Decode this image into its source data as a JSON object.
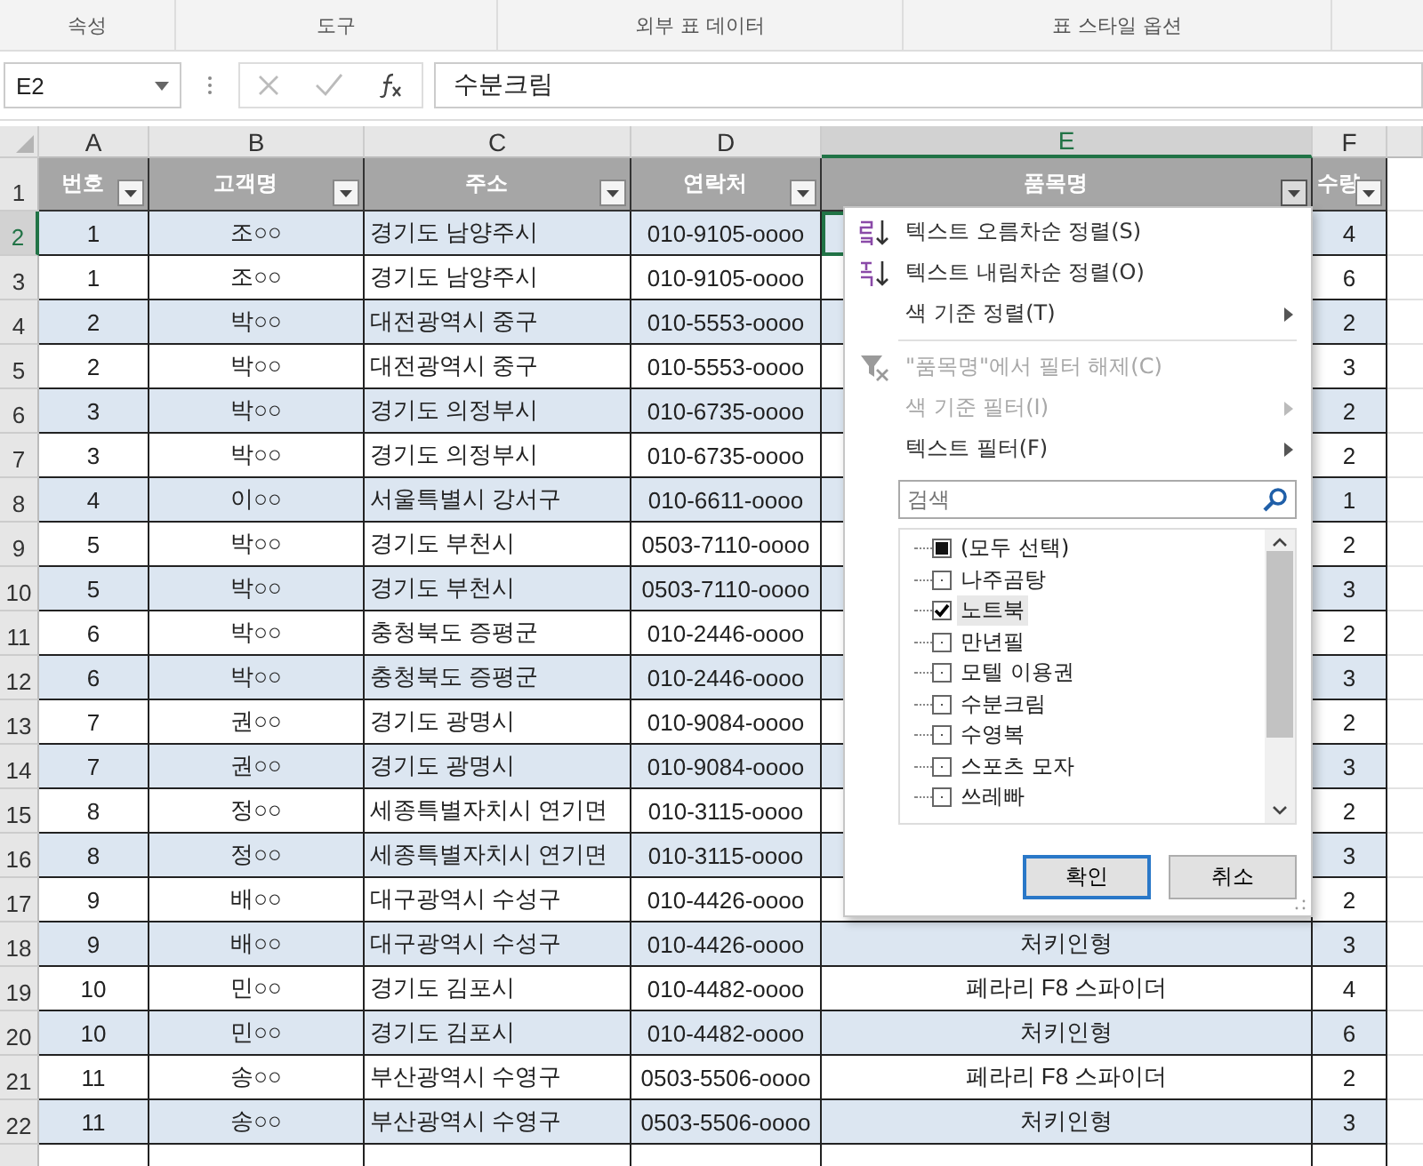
{
  "ribbon_groups": [
    "속성",
    "도구",
    "외부 표 데이터",
    "표 스타일 옵션"
  ],
  "name_box": "E2",
  "formula": "수분크림",
  "columns": [
    {
      "label": "A",
      "selected": false
    },
    {
      "label": "B",
      "selected": false
    },
    {
      "label": "C",
      "selected": false
    },
    {
      "label": "D",
      "selected": false
    },
    {
      "label": "E",
      "selected": true
    },
    {
      "label": "F",
      "selected": false
    }
  ],
  "headers": [
    {
      "label": "번호",
      "filter_open": false
    },
    {
      "label": "고객명",
      "filter_open": false
    },
    {
      "label": "주소",
      "filter_open": false
    },
    {
      "label": "연락처",
      "filter_open": false
    },
    {
      "label": "품목명",
      "filter_open": true
    },
    {
      "label": "수량",
      "filter_open": false
    }
  ],
  "header_row_number": "1",
  "rows": [
    {
      "row_number": "2",
      "selected": true,
      "cells": [
        "1",
        "조○○",
        "경기도 남양주시",
        "010-9105-oooo",
        null,
        "4"
      ]
    },
    {
      "row_number": "3",
      "selected": false,
      "cells": [
        "1",
        "조○○",
        "경기도 남양주시",
        "010-9105-oooo",
        null,
        "6"
      ]
    },
    {
      "row_number": "4",
      "selected": false,
      "cells": [
        "2",
        "박○○",
        "대전광역시 중구",
        "010-5553-oooo",
        null,
        "2"
      ]
    },
    {
      "row_number": "5",
      "selected": false,
      "cells": [
        "2",
        "박○○",
        "대전광역시 중구",
        "010-5553-oooo",
        null,
        "3"
      ]
    },
    {
      "row_number": "6",
      "selected": false,
      "cells": [
        "3",
        "박○○",
        "경기도 의정부시",
        "010-6735-oooo",
        null,
        "2"
      ]
    },
    {
      "row_number": "7",
      "selected": false,
      "cells": [
        "3",
        "박○○",
        "경기도 의정부시",
        "010-6735-oooo",
        null,
        "2"
      ]
    },
    {
      "row_number": "8",
      "selected": false,
      "cells": [
        "4",
        "이○○",
        "서울특별시 강서구",
        "010-6611-oooo",
        null,
        "1"
      ]
    },
    {
      "row_number": "9",
      "selected": false,
      "cells": [
        "5",
        "박○○",
        "경기도 부천시",
        "0503-7110-oooo",
        null,
        "2"
      ]
    },
    {
      "row_number": "10",
      "selected": false,
      "cells": [
        "5",
        "박○○",
        "경기도 부천시",
        "0503-7110-oooo",
        null,
        "3"
      ]
    },
    {
      "row_number": "11",
      "selected": false,
      "cells": [
        "6",
        "박○○",
        "충청북도 증평군",
        "010-2446-oooo",
        null,
        "2"
      ]
    },
    {
      "row_number": "12",
      "selected": false,
      "cells": [
        "6",
        "박○○",
        "충청북도 증평군",
        "010-2446-oooo",
        null,
        "3"
      ]
    },
    {
      "row_number": "13",
      "selected": false,
      "cells": [
        "7",
        "권○○",
        "경기도 광명시",
        "010-9084-oooo",
        null,
        "2"
      ]
    },
    {
      "row_number": "14",
      "selected": false,
      "cells": [
        "7",
        "권○○",
        "경기도 광명시",
        "010-9084-oooo",
        null,
        "3"
      ]
    },
    {
      "row_number": "15",
      "selected": false,
      "cells": [
        "8",
        "정○○",
        "세종특별자치시 연기면",
        "010-3115-oooo",
        null,
        "2"
      ]
    },
    {
      "row_number": "16",
      "selected": false,
      "cells": [
        "8",
        "정○○",
        "세종특별자치시 연기면",
        "010-3115-oooo",
        null,
        "3"
      ]
    },
    {
      "row_number": "17",
      "selected": false,
      "cells": [
        "9",
        "배○○",
        "대구광역시 수성구",
        "010-4426-oooo",
        null,
        "2"
      ]
    },
    {
      "row_number": "18",
      "selected": false,
      "cells": [
        "9",
        "배○○",
        "대구광역시 수성구",
        "010-4426-oooo",
        "처키인형",
        "3"
      ]
    },
    {
      "row_number": "19",
      "selected": false,
      "cells": [
        "10",
        "민○○",
        "경기도 김포시",
        "010-4482-oooo",
        "페라리 F8 스파이더",
        "4"
      ]
    },
    {
      "row_number": "20",
      "selected": false,
      "cells": [
        "10",
        "민○○",
        "경기도 김포시",
        "010-4482-oooo",
        "처키인형",
        "6"
      ]
    },
    {
      "row_number": "21",
      "selected": false,
      "cells": [
        "11",
        "송○○",
        "부산광역시 수영구",
        "0503-5506-oooo",
        "페라리 F8 스파이더",
        "2"
      ]
    },
    {
      "row_number": "22",
      "selected": false,
      "cells": [
        "11",
        "송○○",
        "부산광역시 수영구",
        "0503-5506-oooo",
        "처키인형",
        "3"
      ]
    }
  ],
  "filter_menu": {
    "items": [
      {
        "kind": "sort_asc",
        "label": "텍스트 오름차순 정렬(S)",
        "disabled": false,
        "submenu": false
      },
      {
        "kind": "sort_desc",
        "label": "텍스트 내림차순 정렬(O)",
        "disabled": false,
        "submenu": false
      },
      {
        "kind": "plain",
        "label": "색 기준 정렬(T)",
        "disabled": false,
        "submenu": true
      },
      {
        "kind": "separator"
      },
      {
        "kind": "clear_filter",
        "label": "\"품목명\"에서 필터 해제(C)",
        "disabled": true,
        "submenu": false
      },
      {
        "kind": "plain",
        "label": "색 기준 필터(I)",
        "disabled": true,
        "submenu": true
      },
      {
        "kind": "plain",
        "label": "텍스트 필터(F)",
        "disabled": false,
        "submenu": true
      }
    ],
    "search": {
      "placeholder": "검색"
    },
    "values": [
      {
        "label": "(모두 선택)",
        "checked": false,
        "partial": true,
        "selected": false
      },
      {
        "label": "나주곰탕",
        "checked": false,
        "partial": false,
        "selected": false
      },
      {
        "label": "노트북",
        "checked": true,
        "partial": false,
        "selected": true
      },
      {
        "label": "만년필",
        "checked": false,
        "partial": false,
        "selected": false
      },
      {
        "label": "모텔 이용권",
        "checked": false,
        "partial": false,
        "selected": false
      },
      {
        "label": "수분크림",
        "checked": false,
        "partial": false,
        "selected": false
      },
      {
        "label": "수영복",
        "checked": false,
        "partial": false,
        "selected": false
      },
      {
        "label": "스포츠 모자",
        "checked": false,
        "partial": false,
        "selected": false
      },
      {
        "label": "쓰레빠",
        "checked": false,
        "partial": false,
        "selected": false
      }
    ],
    "buttons": [
      {
        "label": "확인",
        "focused": true
      },
      {
        "label": "취소",
        "focused": false
      }
    ]
  }
}
